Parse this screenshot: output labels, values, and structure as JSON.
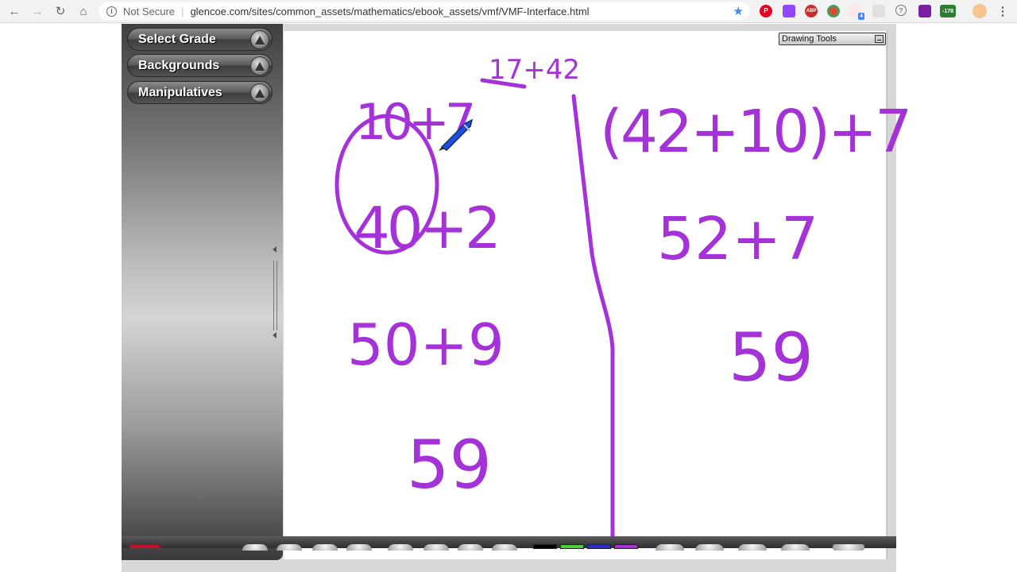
{
  "browser": {
    "back_icon": "arrow-left-icon",
    "forward_icon": "arrow-right-icon",
    "reload_icon": "reload-icon",
    "home_icon": "home-icon",
    "security_label": "Not Secure",
    "url": "glencoe.com/sites/common_assets/mathematics/ebook_assets/vmf/VMF-Interface.html",
    "extensions": [
      {
        "name": "pinterest-icon",
        "color": "#e60023"
      },
      {
        "name": "twitch-icon",
        "color": "#9146ff"
      },
      {
        "name": "adblock-icon",
        "color": "#c4302b",
        "label": "ABP"
      },
      {
        "name": "colorful-extension-icon",
        "color": "#34a853"
      },
      {
        "name": "extension-badge-icon",
        "color": "#ea4335",
        "badge": "4"
      },
      {
        "name": "tab-icon",
        "color": "#9e9e9e"
      },
      {
        "name": "help-icon",
        "color": "#757575"
      },
      {
        "name": "purple-extension-icon",
        "color": "#7b1fa2"
      },
      {
        "name": "green-counter-icon",
        "color": "#2e7d32",
        "badge": "-178"
      },
      {
        "name": "profile-avatar-icon",
        "color": "#f5c48f"
      }
    ]
  },
  "sidebar": {
    "items": [
      {
        "label": "Select Grade"
      },
      {
        "label": "Backgrounds"
      },
      {
        "label": "Manipulatives"
      }
    ]
  },
  "drawing_tools": {
    "title": "Drawing Tools"
  },
  "canvas": {
    "ink_color": "#a432d8",
    "header_problem": "17+42",
    "left_work": [
      "10+7",
      "40+2",
      "50+9",
      "59"
    ],
    "right_work": [
      "(42+10)+7",
      "52+7",
      "59"
    ]
  },
  "toolbar": {
    "colors": [
      "#000000",
      "#4ad038",
      "#2b2bd0",
      "#a432d8"
    ]
  }
}
